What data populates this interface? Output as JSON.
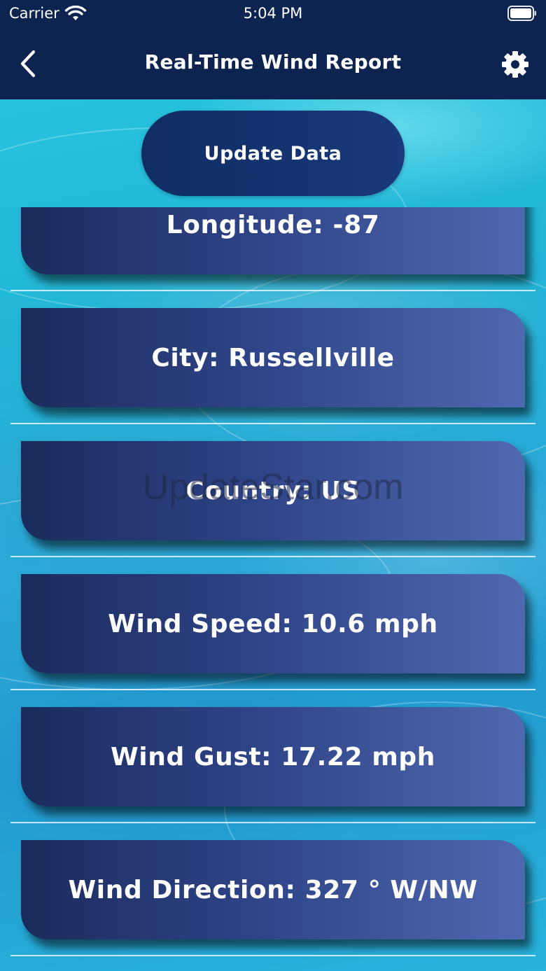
{
  "status_bar": {
    "carrier": "Carrier",
    "time": "5:04 PM"
  },
  "nav": {
    "title": "Real-Time Wind Report",
    "back_icon": "chevron-left-icon",
    "settings_icon": "gear-icon"
  },
  "update_button": {
    "label": "Update Data"
  },
  "rows": [
    {
      "label": "Longitude: -87"
    },
    {
      "label": "City: Russellville"
    },
    {
      "label": "Country: US"
    },
    {
      "label": "Wind Speed: 10.6 mph"
    },
    {
      "label": "Wind Gust: 17.22 mph"
    },
    {
      "label": "Wind Direction: 327 ° W/NW"
    }
  ],
  "watermark": "UpdateStar.com",
  "colors": {
    "nav_background": "#0d2350",
    "card_gradient_start": "#1a2b5c",
    "card_gradient_end": "#5068b0",
    "background_accent": "#27c3de"
  }
}
